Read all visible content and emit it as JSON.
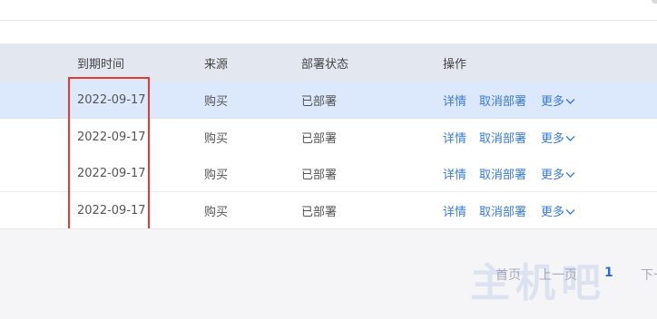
{
  "table": {
    "headers": {
      "date": "到期时间",
      "source": "来源",
      "status": "部署状态",
      "ops": "操作"
    },
    "rows": [
      {
        "date": "2022-09-17",
        "source": "购买",
        "status": "已部署",
        "detail": "详情",
        "cancel": "取消部署",
        "more": "更多",
        "highlighted": true
      },
      {
        "date": "2022-09-17",
        "source": "购买",
        "status": "已部署",
        "detail": "详情",
        "cancel": "取消部署",
        "more": "更多",
        "highlighted": false
      },
      {
        "date": "2022-09-17",
        "source": "购买",
        "status": "已部署",
        "detail": "详情",
        "cancel": "取消部署",
        "more": "更多",
        "highlighted": false
      },
      {
        "date": "2022-09-17",
        "source": "购买",
        "status": "已部署",
        "detail": "详情",
        "cancel": "取消部署",
        "more": "更多",
        "highlighted": false
      }
    ]
  },
  "pagination": {
    "first": "首页",
    "prev": "上一页",
    "current": "1",
    "next": "下一"
  },
  "watermark": "主机吧",
  "colors": {
    "accent": "#3a7bd5",
    "highlight_row": "#dce8fb",
    "annotation_box": "#e53935",
    "header_bg": "#e3e7ef"
  },
  "icons": {
    "more_dropdown": "chevron-down-icon"
  }
}
